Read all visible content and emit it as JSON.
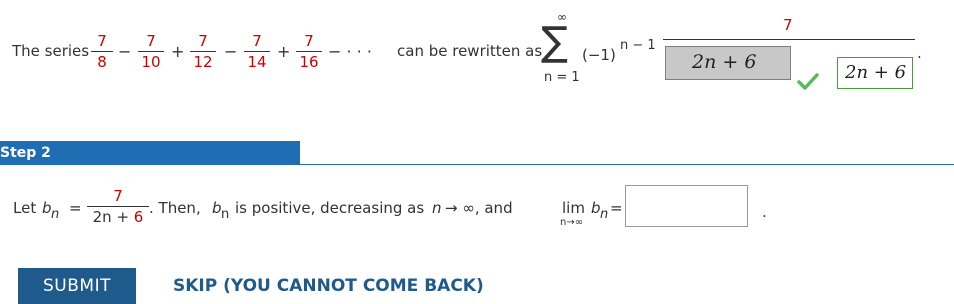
{
  "step1": {
    "intro": "The series",
    "terms": [
      {
        "num": "7",
        "den": "8"
      },
      {
        "num": "7",
        "den": "10"
      },
      {
        "num": "7",
        "den": "12"
      },
      {
        "num": "7",
        "den": "14"
      },
      {
        "num": "7",
        "den": "16"
      }
    ],
    "ops": [
      "−",
      "+",
      "−",
      "+",
      "− · · ·"
    ],
    "rewrite_text": "can be rewritten as",
    "sum_upper": "∞",
    "sum_symbol": "∑",
    "sum_lower": "n = 1",
    "sign_factor": "(−1)",
    "exponent": "n − 1",
    "result_numerator": "7",
    "submitted_answer": "2n + 6",
    "correct_answer": "2n + 6",
    "period": "."
  },
  "step2": {
    "heading": "Step 2",
    "let_text": "Let",
    "b": "b",
    "sub_n": "n",
    "equals": "=",
    "frac_num": "7",
    "frac_den_prefix": "2n + ",
    "frac_den_red": "6",
    "then_text": ". Then,",
    "sub_n2": "n",
    "middle_text": "is positive, decreasing as",
    "n_var": "n",
    "arrow_inf": "→ ∞, and",
    "lim": "lim",
    "lim_sub": "n→∞",
    "b2": "b",
    "sub_n3": "n",
    "equals2": "=",
    "input_value": "",
    "period": "."
  },
  "actions": {
    "submit_label": "SUBMIT",
    "skip_label": "SKIP (YOU CANNOT COME BACK)"
  },
  "colors": {
    "accent": "#1f6eb3",
    "red": "#cc0000",
    "check": "#5cb85c"
  }
}
